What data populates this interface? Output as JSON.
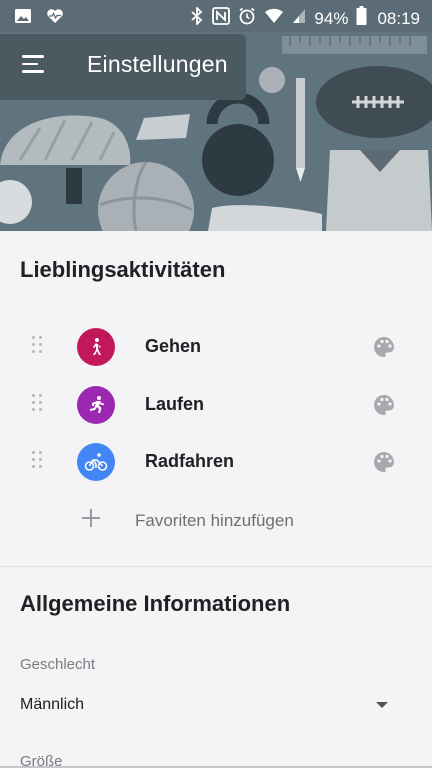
{
  "status_bar": {
    "battery": "94%",
    "time": "08:19",
    "icons": [
      "image-icon",
      "heart-pulse-icon",
      "bluetooth-icon",
      "nfc-icon",
      "alarm-icon",
      "wifi-icon",
      "signal-icon",
      "battery-icon"
    ]
  },
  "toolbar": {
    "title": "Einstellungen",
    "menu_icon": "menu-icon"
  },
  "favorites": {
    "title": "Lieblingsaktivitäten",
    "items": [
      {
        "label": "Gehen",
        "icon": "walking-icon",
        "color": "#c2185b"
      },
      {
        "label": "Laufen",
        "icon": "running-icon",
        "color": "#9c27b0"
      },
      {
        "label": "Radfahren",
        "icon": "cycling-icon",
        "color": "#4285f4"
      }
    ],
    "add_label": "Favoriten hinzufügen"
  },
  "general": {
    "title": "Allgemeine Informationen",
    "gender_label": "Geschlecht",
    "gender_value": "Männlich",
    "height_label": "Größe"
  },
  "colors": {
    "header_bg": "#607480",
    "toolbar_bg": "#4b5960",
    "content_bg": "#f4f3f5"
  }
}
